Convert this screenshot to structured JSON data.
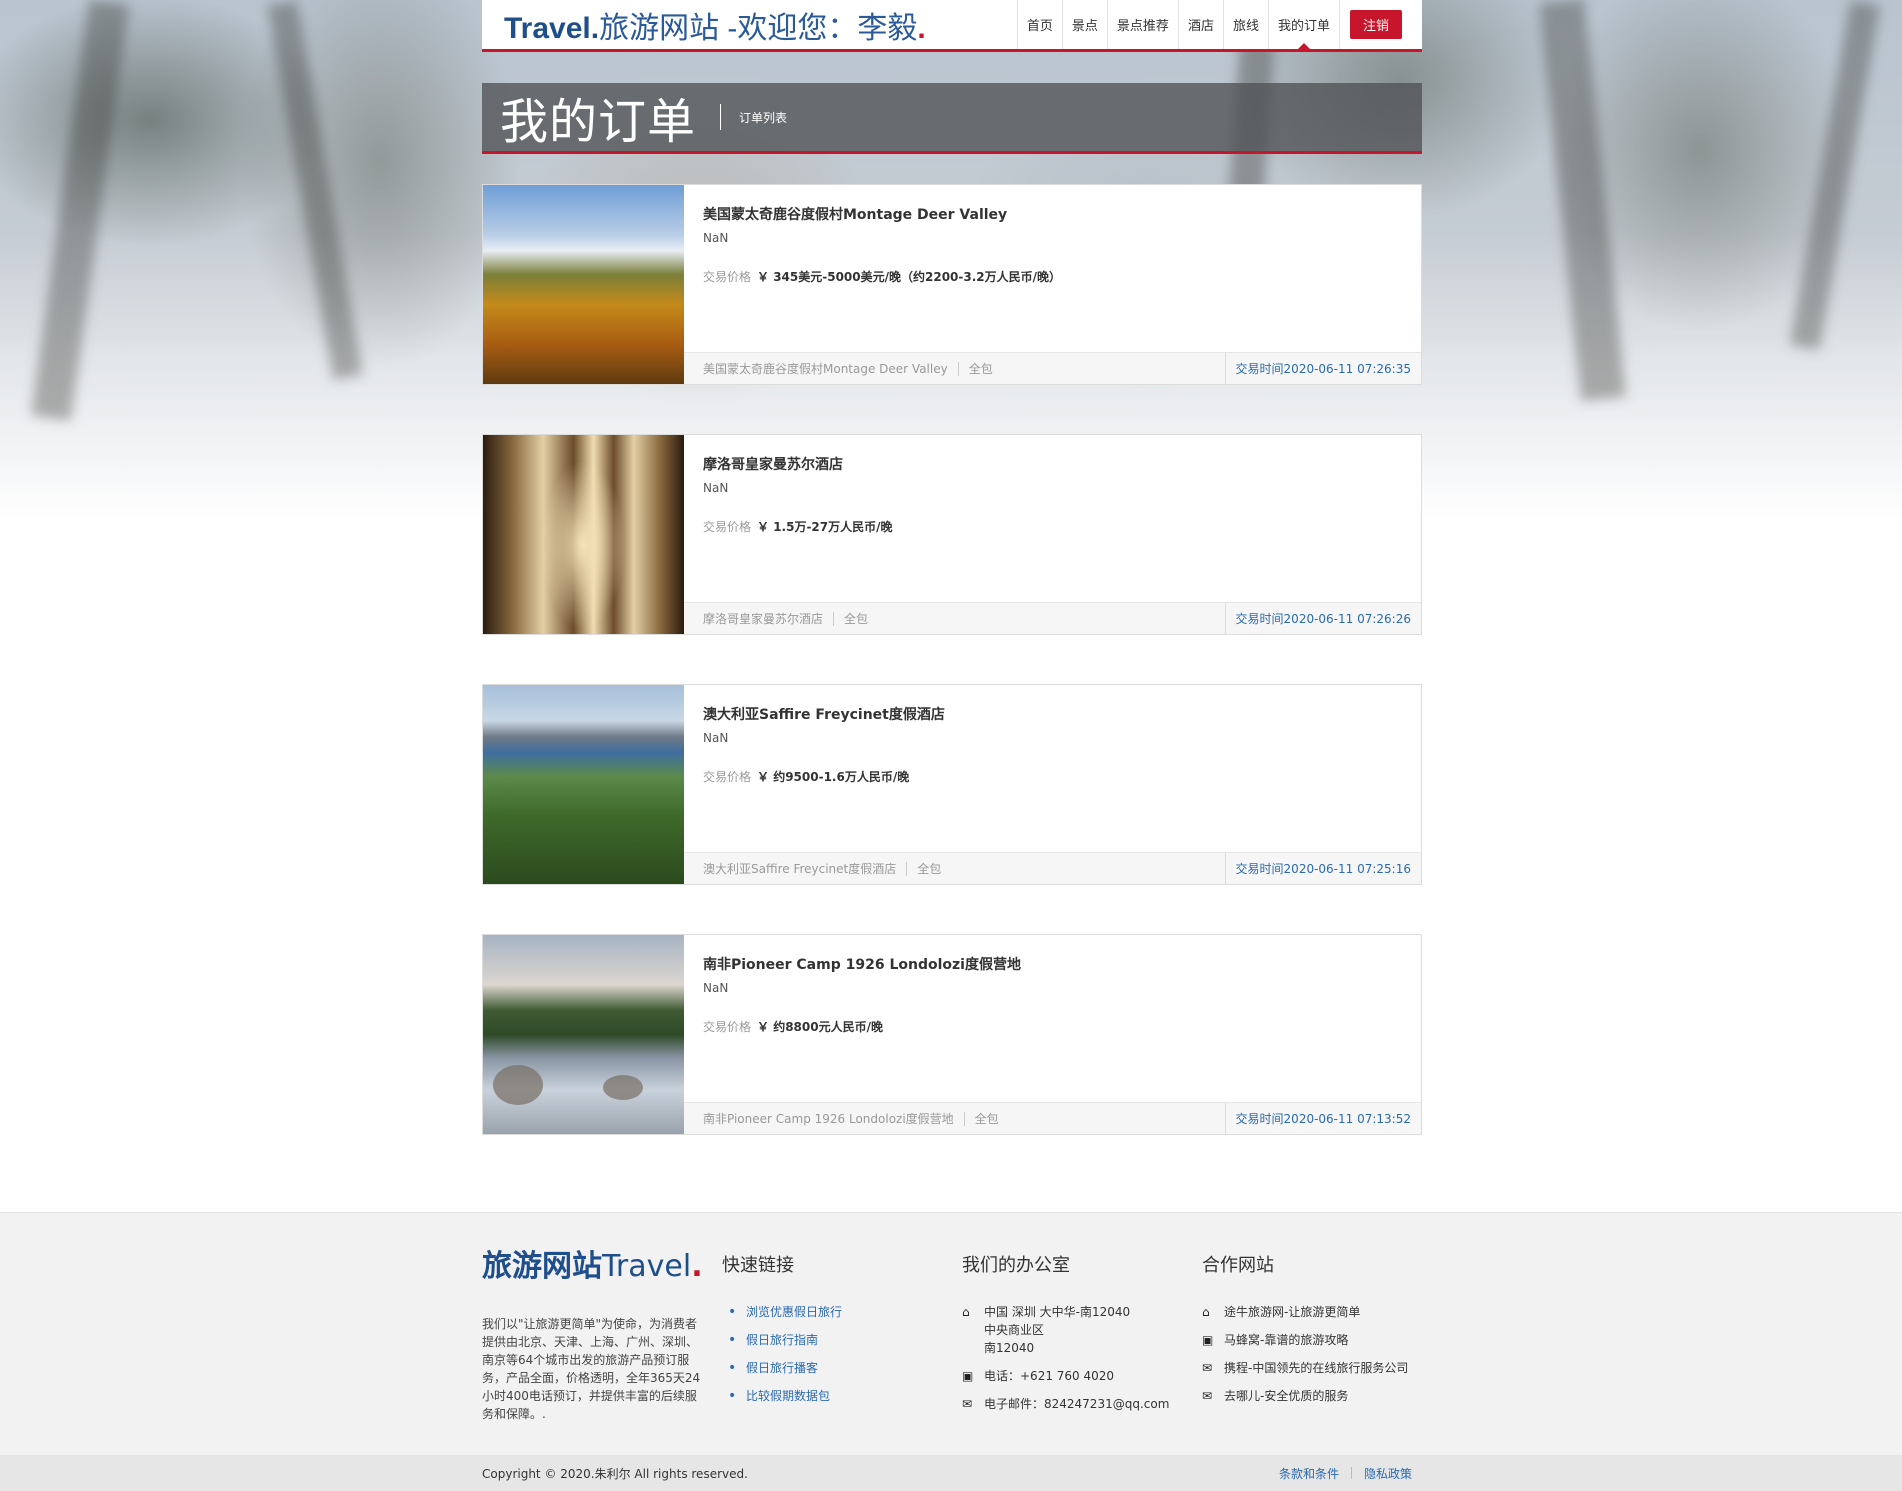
{
  "header": {
    "logo_brand": "Travel.",
    "logo_rest": "旅游网站 -欢迎您：李毅",
    "logo_dot": ".",
    "nav": [
      "首页",
      "景点",
      "景点推荐",
      "酒店",
      "旅线",
      "我的订单"
    ],
    "logout": "注销"
  },
  "titlebar": {
    "title": "我的订单",
    "subtitle": "订单列表"
  },
  "orders": [
    {
      "name": "美国蒙太奇鹿谷度假村Montage Deer Valley",
      "nan": "NaN",
      "price_label": "交易价格",
      "price": "￥ 345美元-5000美元/晚（约2200-3.2万人民币/晚）",
      "foot_name": "美国蒙太奇鹿谷度假村Montage Deer Valley",
      "package": "全包",
      "time": "交易时间2020-06-11 07:26:35"
    },
    {
      "name": "摩洛哥皇家曼苏尔酒店",
      "nan": "NaN",
      "price_label": "交易价格",
      "price": "￥ 1.5万-27万人民币/晚",
      "foot_name": "摩洛哥皇家曼苏尔酒店",
      "package": "全包",
      "time": "交易时间2020-06-11 07:26:26"
    },
    {
      "name": "澳大利亚Saffire Freycinet度假酒店",
      "nan": "NaN",
      "price_label": "交易价格",
      "price": "￥ 约9500-1.6万人民币/晚",
      "foot_name": "澳大利亚Saffire Freycinet度假酒店",
      "package": "全包",
      "time": "交易时间2020-06-11 07:25:16"
    },
    {
      "name": "南非Pioneer Camp 1926 Londolozi度假营地",
      "nan": "NaN",
      "price_label": "交易价格",
      "price": "￥ 约8800元人民币/晚",
      "foot_name": "南非Pioneer Camp 1926 Londolozi度假营地",
      "package": "全包",
      "time": "交易时间2020-06-11 07:13:52"
    }
  ],
  "footer": {
    "logo_bold": "旅游网站",
    "logo_text": "Travel",
    "logo_dot": ".",
    "description": "我们以\"让旅游更简单\"为使命，为消费者提供由北京、天津、上海、广州、深圳、南京等64个城市出发的旅游产品预订服务，产品全面，价格透明，全年365天24小时400电话预订，并提供丰富的后续服务和保障。.",
    "quick_links_title": "快速链接",
    "quick_links": [
      "浏览优惠假日旅行",
      "假日旅行指南",
      "假日旅行播客",
      "比较假期数据包"
    ],
    "office_title": "我们的办公室",
    "office": {
      "address_line1": "中国 深圳 大中华-南12040",
      "address_line2": "中央商业区",
      "address_line3": "南12040",
      "phone": "电话：+621 760 4020",
      "email": "电子邮件：824247231@qq.com"
    },
    "partners_title": "合作网站",
    "partners": [
      "途牛旅游网-让旅游更简单",
      "马蜂窝-靠谱的旅游攻略",
      "携程-中国领先的在线旅行服务公司",
      "去哪儿-安全优质的服务"
    ],
    "icons": {
      "home": "home-icon",
      "briefcase": "briefcase-icon",
      "mail": "mail-icon"
    }
  },
  "copyright": {
    "text": "Copyright © 2020.朱利尔 All rights reserved.",
    "terms": "条款和条件",
    "privacy": "隐私政策"
  },
  "colors": {
    "accent": "#c7162b",
    "brand_blue": "#1f4e8c",
    "link_blue": "#2a6ab0"
  }
}
